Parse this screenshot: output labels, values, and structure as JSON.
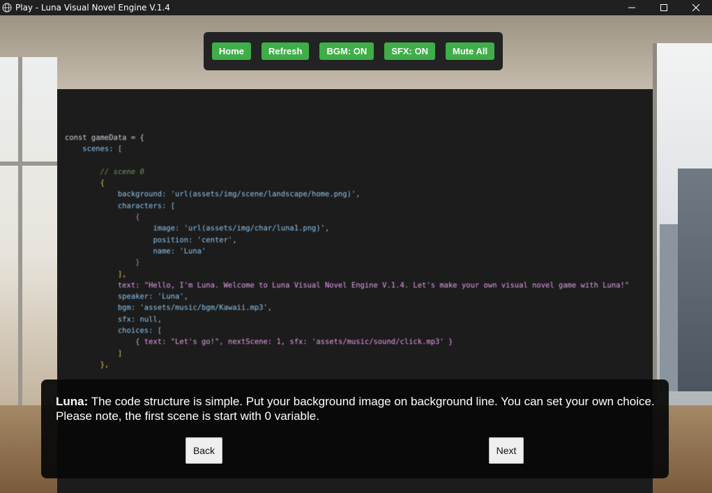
{
  "window": {
    "title": "Play - Luna Visual Novel Engine V.1.4",
    "icon": "globe-icon",
    "controls": [
      "minimize-icon",
      "maximize-icon",
      "close-icon"
    ]
  },
  "menu": {
    "home": "Home",
    "refresh": "Refresh",
    "bgm": "BGM: ON",
    "sfx": "SFX: ON",
    "mute": "Mute All",
    "button_color": "#3fae49"
  },
  "code": {
    "l1": "const gameData = {",
    "l2": "scenes: [",
    "l3": "// scene 0",
    "l4": "{",
    "l5": "background: 'url(assets/img/scene/landscape/home.png)',",
    "l6": "characters: [",
    "l7": "{",
    "l8": "image: 'url(assets/img/char/luna1.png)',",
    "l9": "position: 'center',",
    "l10": "name: 'Luna'",
    "l11": "}",
    "l12": "],",
    "l13": "text: \"Hello, I'm Luna. Welcome to Luna Visual Novel Engine V.1.4. Let's make your own visual novel game with Luna!\"",
    "l14": "speaker: 'Luna',",
    "l15": "bgm: 'assets/music/bgm/Kawaii.mp3',",
    "l16": "sfx: null,",
    "l17": "choices: [",
    "l18": "{ text: \"Let's go!\", nextScene: 1, sfx: 'assets/music/sound/click.mp3' }",
    "l19": "]",
    "l20": "},"
  },
  "dialogue": {
    "speaker": "Luna:",
    "text": "The code structure is simple. Put your background image on background line. You can set your own choice. Please note, the first scene is start with 0 variable.",
    "back": "Back",
    "next": "Next"
  }
}
